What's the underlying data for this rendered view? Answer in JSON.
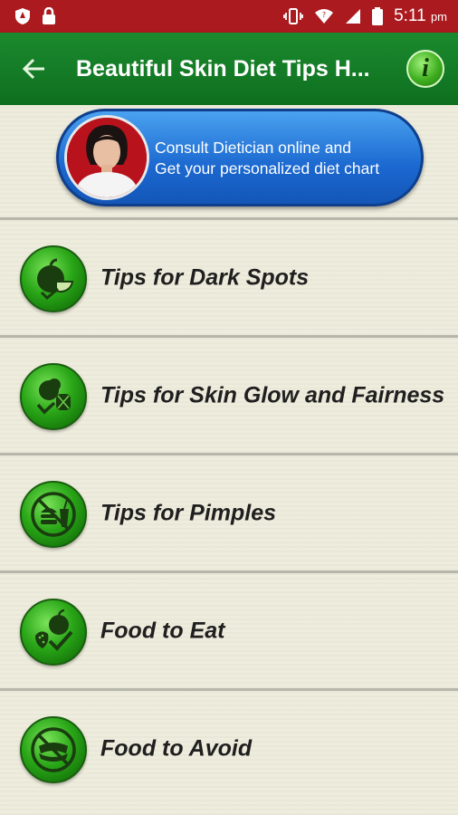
{
  "status_bar": {
    "time": "5:11",
    "ampm": "pm",
    "icons": [
      "shield-icon",
      "lock-icon",
      "vibrate-icon",
      "wifi-icon",
      "signal-icon",
      "battery-icon"
    ]
  },
  "app_bar": {
    "title": "Beautiful Skin Diet Tips H...",
    "info_glyph": "i",
    "colors": {
      "status_bar": "#ab1a1e",
      "app_bar": "#1b8a2e",
      "banner": "#1b68d0"
    }
  },
  "banner": {
    "line1": "Consult Dietician online and",
    "line2": "Get your personalized diet chart"
  },
  "menu": {
    "items": [
      {
        "label": "Tips for Dark Spots",
        "icon": "apple-lime-icon"
      },
      {
        "label": "Tips for Skin Glow and Fairness",
        "icon": "vegetables-icon"
      },
      {
        "label": "Tips for Pimples",
        "icon": "no-junk-food-icon"
      },
      {
        "label": "Food to Eat",
        "icon": "fruits-check-icon"
      },
      {
        "label": "Food to Avoid",
        "icon": "no-hotdog-icon"
      }
    ]
  }
}
